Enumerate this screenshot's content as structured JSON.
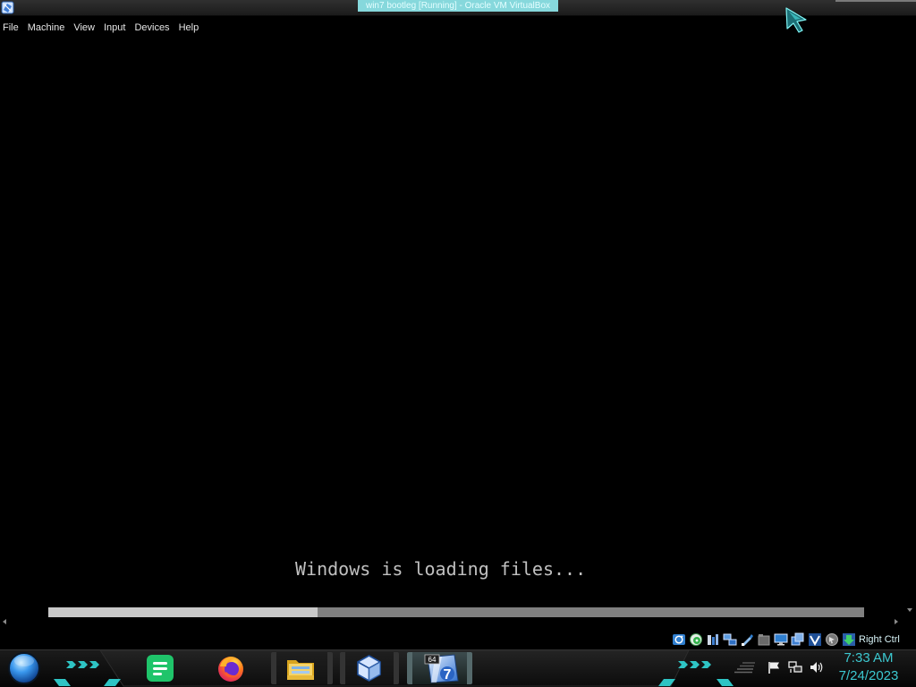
{
  "window": {
    "title": "win7 bootleg [Running] - Oracle VM VirtualBox",
    "icon": "virtualbox-window-icon"
  },
  "menu": [
    {
      "label": "File"
    },
    {
      "label": "Machine"
    },
    {
      "label": "View"
    },
    {
      "label": "Input"
    },
    {
      "label": "Devices"
    },
    {
      "label": "Help"
    }
  ],
  "console": {
    "message": "Windows is loading files...",
    "progress": 0.33
  },
  "cursor": {
    "icon": "mouse-cursor-icon"
  },
  "status_bar": {
    "indicators": [
      "hard-disk-icon",
      "optical-drive-icon",
      "audio-icon",
      "vm-network-icon",
      "usb-icon",
      "shared-folders-icon",
      "display-icon",
      "recording-icon",
      "cpu-features-icon",
      "mouse-integration-icon",
      "keyboard-capture-icon"
    ],
    "host_key": "Right Ctrl"
  },
  "taskbar": {
    "start_icon": "start-orb-icon",
    "apps": [
      {
        "icon": "notes-app-icon",
        "open": false
      },
      {
        "icon": "firefox-icon",
        "open": false
      },
      {
        "icon": "file-explorer-icon",
        "open": true
      },
      {
        "icon": "virtualbox-icon",
        "open": true
      },
      {
        "icon": "win7-vm-icon",
        "open": true,
        "active": true,
        "badge": "64",
        "glyph": "7"
      }
    ],
    "tray": [
      "action-center-flag-icon",
      "tray-network-icon",
      "volume-icon"
    ],
    "clock": {
      "time": "7:33 AM",
      "date": "7/24/2023"
    }
  },
  "colors": {
    "accent": "#2ec4c4",
    "console_text": "#c0c0c0",
    "progress_fill": "#c8c8c8",
    "progress_track": "#808080",
    "clock_text": "#3cc8d0",
    "title_highlight": "#86d8dc",
    "title_text": "#e4feff"
  }
}
